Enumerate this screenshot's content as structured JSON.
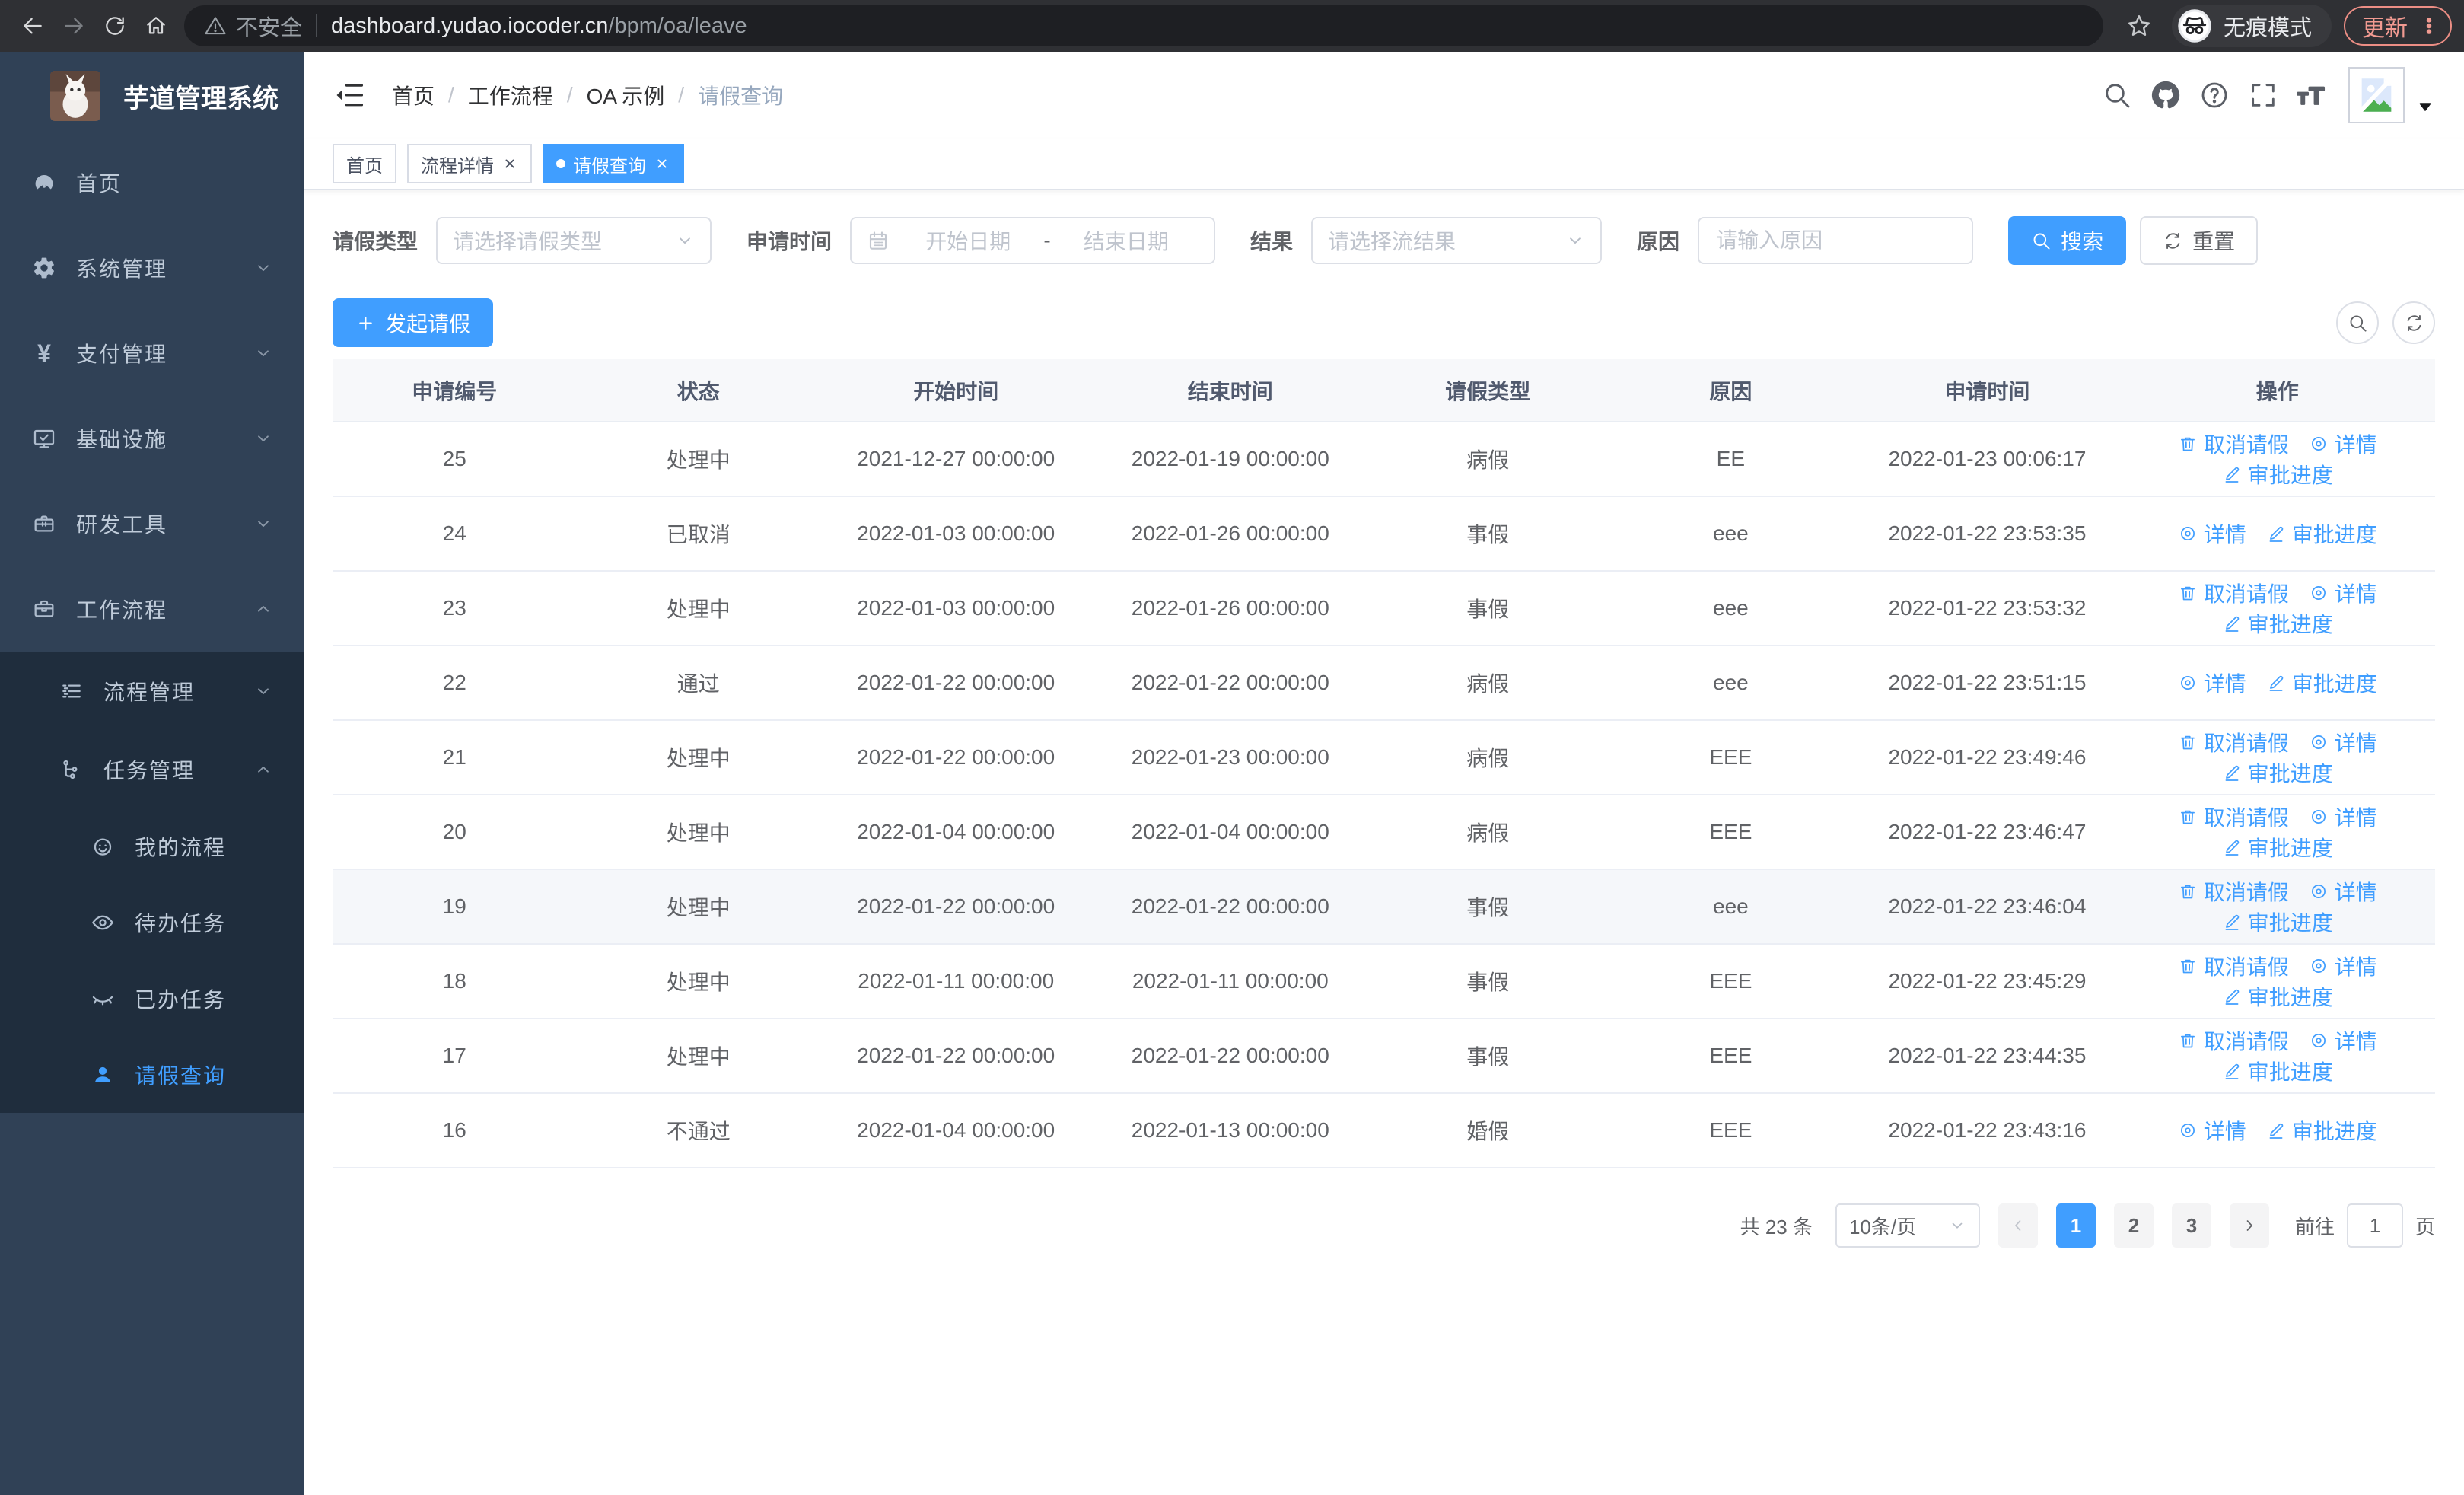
{
  "colors": {
    "primary": "#409eff",
    "sidebar_bg": "#304156",
    "submenu_bg": "#1f2d3d",
    "update_accent": "#f19a91"
  },
  "browser": {
    "insecure_label": "不安全",
    "url_host": "dashboard.yudao.iocoder.cn",
    "url_path": "/bpm/oa/leave",
    "incognito_label": "无痕模式",
    "update_label": "更新"
  },
  "sidebar": {
    "title": "芋道管理系统",
    "items": [
      {
        "label": "首页",
        "icon": "dashboard-icon",
        "level": 1
      },
      {
        "label": "系统管理",
        "icon": "gear-icon",
        "level": 1,
        "chevron": "down"
      },
      {
        "label": "支付管理",
        "icon": "yen-icon",
        "level": 1,
        "chevron": "down"
      },
      {
        "label": "基础设施",
        "icon": "monitor-icon",
        "level": 1,
        "chevron": "down"
      },
      {
        "label": "研发工具",
        "icon": "toolbox-icon",
        "level": 1,
        "chevron": "down"
      },
      {
        "label": "工作流程",
        "icon": "briefcase-icon",
        "level": 1,
        "chevron": "up"
      },
      {
        "label": "流程管理",
        "icon": "list-icon",
        "level": 2,
        "chevron": "down"
      },
      {
        "label": "任务管理",
        "icon": "tree-icon",
        "level": 2,
        "chevron": "up"
      },
      {
        "label": "我的流程",
        "icon": "face-icon",
        "level": 3
      },
      {
        "label": "待办任务",
        "icon": "eye-icon",
        "level": 3
      },
      {
        "label": "已办任务",
        "icon": "eye-closed-icon",
        "level": 3
      },
      {
        "label": "请假查询",
        "icon": "user-icon",
        "level": 3,
        "active": true
      }
    ]
  },
  "breadcrumb": [
    "首页",
    "工作流程",
    "OA 示例",
    "请假查询"
  ],
  "tabs": [
    {
      "label": "首页",
      "closable": false,
      "active": false
    },
    {
      "label": "流程详情",
      "closable": true,
      "active": false
    },
    {
      "label": "请假查询",
      "closable": true,
      "active": true
    }
  ],
  "filters": {
    "leave_type_label": "请假类型",
    "leave_type_placeholder": "请选择请假类型",
    "apply_time_label": "申请时间",
    "start_date_placeholder": "开始日期",
    "range_separator": "-",
    "end_date_placeholder": "结束日期",
    "result_label": "结果",
    "result_placeholder": "请选择流结果",
    "reason_label": "原因",
    "reason_placeholder": "请输入原因",
    "search_label": "搜索",
    "reset_label": "重置"
  },
  "toolbar": {
    "create_label": "发起请假"
  },
  "table": {
    "columns": [
      {
        "key": "id",
        "label": "申请编号"
      },
      {
        "key": "status",
        "label": "状态"
      },
      {
        "key": "start",
        "label": "开始时间"
      },
      {
        "key": "end",
        "label": "结束时间"
      },
      {
        "key": "type",
        "label": "请假类型"
      },
      {
        "key": "reason",
        "label": "原因"
      },
      {
        "key": "applyTime",
        "label": "申请时间"
      },
      {
        "key": "ops",
        "label": "操作"
      }
    ],
    "action_labels": {
      "cancel": "取消请假",
      "detail": "详情",
      "progress": "审批进度"
    },
    "rows": [
      {
        "id": "25",
        "status": "处理中",
        "start": "2021-12-27 00:00:00",
        "end": "2022-01-19 00:00:00",
        "type": "病假",
        "reason": "EE",
        "applyTime": "2022-01-23 00:06:17",
        "actions": [
          "cancel",
          "detail",
          "progress"
        ]
      },
      {
        "id": "24",
        "status": "已取消",
        "start": "2022-01-03 00:00:00",
        "end": "2022-01-26 00:00:00",
        "type": "事假",
        "reason": "eee",
        "applyTime": "2022-01-22 23:53:35",
        "actions": [
          "detail",
          "progress"
        ]
      },
      {
        "id": "23",
        "status": "处理中",
        "start": "2022-01-03 00:00:00",
        "end": "2022-01-26 00:00:00",
        "type": "事假",
        "reason": "eee",
        "applyTime": "2022-01-22 23:53:32",
        "actions": [
          "cancel",
          "detail",
          "progress"
        ]
      },
      {
        "id": "22",
        "status": "通过",
        "start": "2022-01-22 00:00:00",
        "end": "2022-01-22 00:00:00",
        "type": "病假",
        "reason": "eee",
        "applyTime": "2022-01-22 23:51:15",
        "actions": [
          "detail",
          "progress"
        ]
      },
      {
        "id": "21",
        "status": "处理中",
        "start": "2022-01-22 00:00:00",
        "end": "2022-01-23 00:00:00",
        "type": "病假",
        "reason": "EEE",
        "applyTime": "2022-01-22 23:49:46",
        "actions": [
          "cancel",
          "detail",
          "progress"
        ]
      },
      {
        "id": "20",
        "status": "处理中",
        "start": "2022-01-04 00:00:00",
        "end": "2022-01-04 00:00:00",
        "type": "病假",
        "reason": "EEE",
        "applyTime": "2022-01-22 23:46:47",
        "actions": [
          "cancel",
          "detail",
          "progress"
        ]
      },
      {
        "id": "19",
        "status": "处理中",
        "start": "2022-01-22 00:00:00",
        "end": "2022-01-22 00:00:00",
        "type": "事假",
        "reason": "eee",
        "applyTime": "2022-01-22 23:46:04",
        "actions": [
          "cancel",
          "detail",
          "progress"
        ],
        "highlight": true
      },
      {
        "id": "18",
        "status": "处理中",
        "start": "2022-01-11 00:00:00",
        "end": "2022-01-11 00:00:00",
        "type": "事假",
        "reason": "EEE",
        "applyTime": "2022-01-22 23:45:29",
        "actions": [
          "cancel",
          "detail",
          "progress"
        ]
      },
      {
        "id": "17",
        "status": "处理中",
        "start": "2022-01-22 00:00:00",
        "end": "2022-01-22 00:00:00",
        "type": "事假",
        "reason": "EEE",
        "applyTime": "2022-01-22 23:44:35",
        "actions": [
          "cancel",
          "detail",
          "progress"
        ]
      },
      {
        "id": "16",
        "status": "不通过",
        "start": "2022-01-04 00:00:00",
        "end": "2022-01-13 00:00:00",
        "type": "婚假",
        "reason": "EEE",
        "applyTime": "2022-01-22 23:43:16",
        "actions": [
          "detail",
          "progress"
        ]
      }
    ]
  },
  "pagination": {
    "total_label": "共 23 条",
    "size_label": "10条/页",
    "pages": [
      "1",
      "2",
      "3"
    ],
    "active_page": "1",
    "goto_label": "前往",
    "goto_value": "1",
    "page_unit": "页"
  }
}
